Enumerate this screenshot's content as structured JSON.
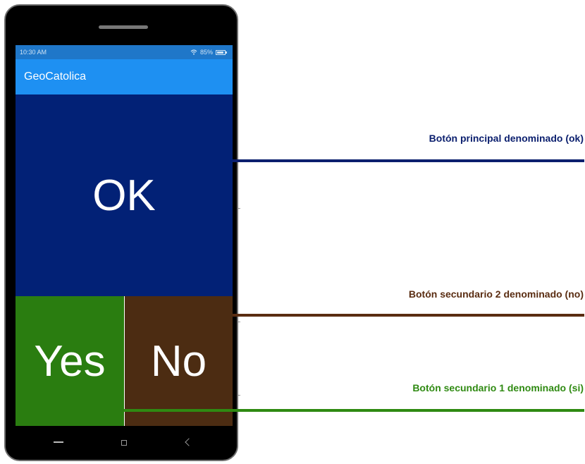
{
  "status_bar": {
    "time": "10:30 AM",
    "wifi_icon": "wifi-icon",
    "battery_percent": "85%",
    "battery_icon": "battery-icon"
  },
  "app_bar": {
    "title": "GeoCatolica"
  },
  "buttons": {
    "ok": {
      "label": "OK",
      "color": "#022176"
    },
    "yes": {
      "label": "Yes",
      "color": "#2a7d10"
    },
    "no": {
      "label": "No",
      "color": "#4c2c12"
    }
  },
  "navigation": {
    "back_icon": "back-icon",
    "home_icon": "home-icon",
    "recent_icon": "recent-apps-icon"
  },
  "callouts": [
    {
      "text": "Botón principal denominado (ok)",
      "color": "#0b1f6e"
    },
    {
      "text": "Botón secundario 2 denominado (no)",
      "color": "#5a2d12"
    },
    {
      "text": "Botón secundario 1 denominado (si)",
      "color": "#2f8a12"
    }
  ]
}
